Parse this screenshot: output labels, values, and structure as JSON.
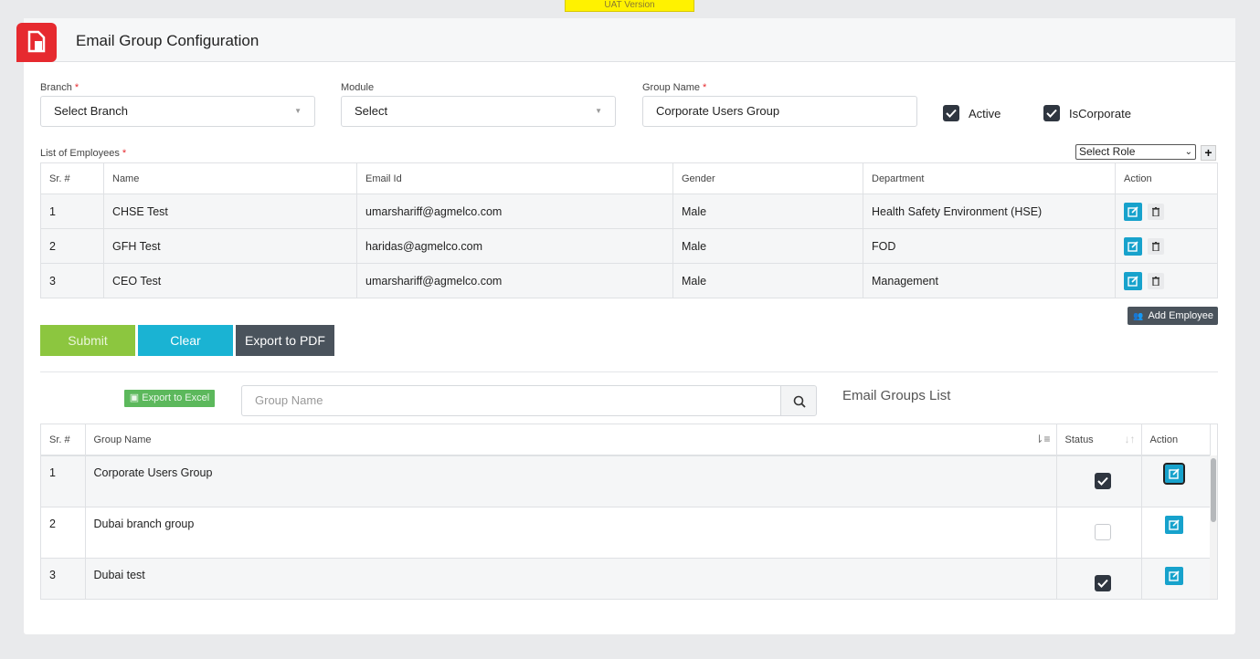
{
  "banner": {
    "text": "UAT Version"
  },
  "header": {
    "title": "Email Group Configuration",
    "logo_icon": "document-icon"
  },
  "form": {
    "branch": {
      "label": "Branch",
      "required": "*",
      "value": "Select Branch"
    },
    "module": {
      "label": "Module",
      "value": "Select"
    },
    "group_name": {
      "label": "Group Name",
      "required": "*",
      "value": "Corporate Users Group"
    },
    "active": {
      "label": "Active",
      "checked": true
    },
    "is_corporate": {
      "label": "IsCorporate",
      "checked": true
    }
  },
  "employees": {
    "label": "List of Employees",
    "required": "*",
    "role_select": "Select Role",
    "add_icon": "+",
    "columns": [
      "Sr. #",
      "Name",
      "Email Id",
      "Gender",
      "Department",
      "Action"
    ],
    "rows": [
      [
        "1",
        "CHSE Test",
        "umarshariff@agmelco.com",
        "Male",
        "Health Safety Environment (HSE)"
      ],
      [
        "2",
        "GFH Test",
        "haridas@agmelco.com",
        "Male",
        "FOD"
      ],
      [
        "3",
        "CEO Test",
        "umarshariff@agmelco.com",
        "Male",
        "Management"
      ]
    ],
    "add_employee": "Add Employee"
  },
  "buttons": {
    "submit": "Submit",
    "clear": "Clear",
    "export_pdf": "Export to PDF"
  },
  "list": {
    "export_excel": "Export to Excel",
    "search_placeholder": "Group Name",
    "title": "Email Groups List",
    "columns": [
      "Sr. #",
      "Group Name",
      "Status",
      "Action"
    ],
    "rows": [
      {
        "sr": "1",
        "name": "Corporate Users Group",
        "status": true
      },
      {
        "sr": "2",
        "name": "Dubai branch group",
        "status": false
      },
      {
        "sr": "3",
        "name": "Dubai test",
        "status": true
      }
    ]
  },
  "colors": {
    "accent": "#17a2cc",
    "submit": "#8cc63f",
    "clear": "#1ab3d3",
    "dark": "#4a535c",
    "logo": "#e62a2f",
    "banner": "#fff200"
  }
}
